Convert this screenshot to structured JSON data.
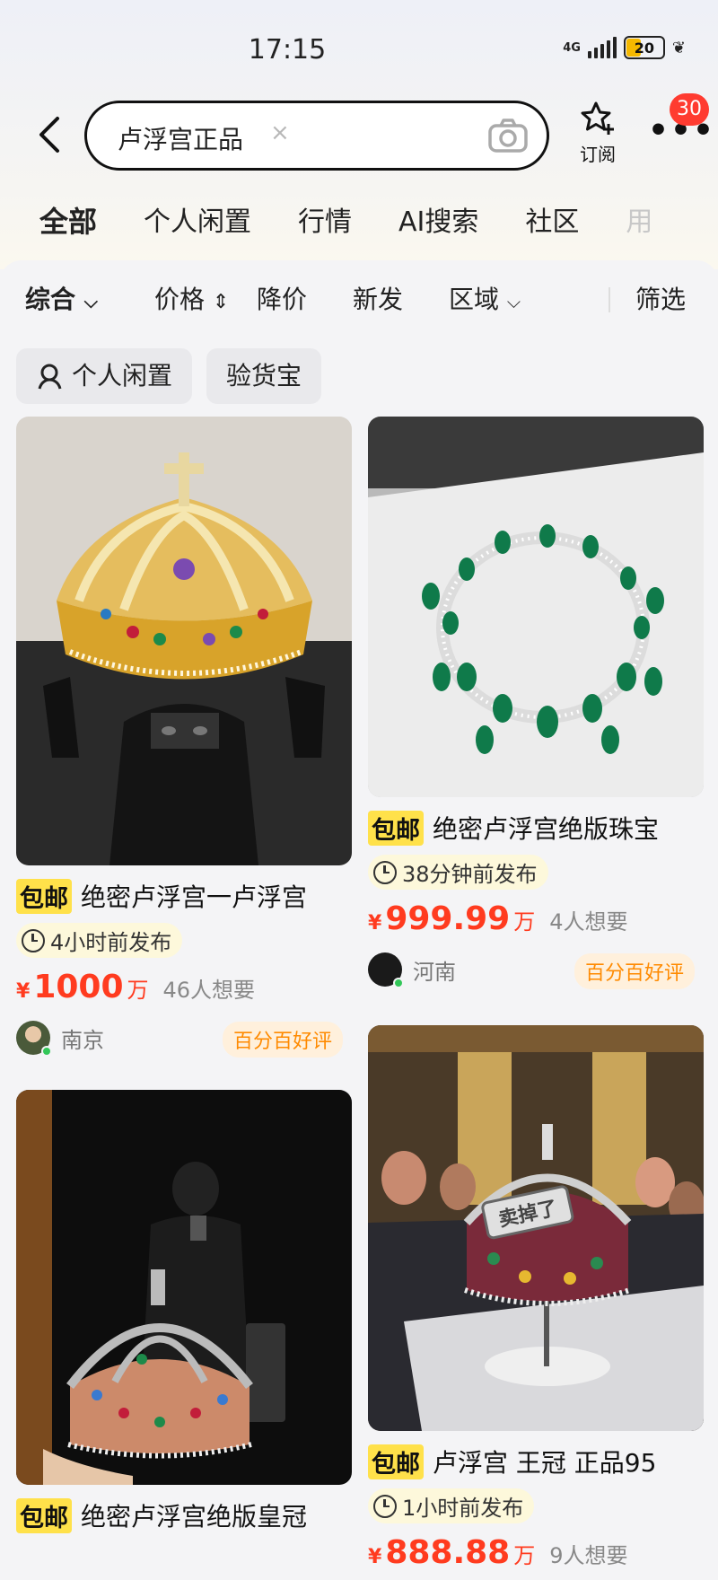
{
  "status_bar": {
    "time": "17:15",
    "network": "4G",
    "battery": "20"
  },
  "search": {
    "query": "卢浮宫正品",
    "clear_icon": "×"
  },
  "header": {
    "subscribe_label": "订阅",
    "message_badge": "30"
  },
  "tabs": [
    {
      "label": "全部",
      "active": true
    },
    {
      "label": "个人闲置"
    },
    {
      "label": "行情"
    },
    {
      "label": "AI搜索"
    },
    {
      "label": "社区"
    },
    {
      "label": "用"
    }
  ],
  "filters": [
    {
      "label": "综合",
      "icon": "chevron-down"
    },
    {
      "label": "价格",
      "icon": "sort-updown"
    },
    {
      "label": "降价"
    },
    {
      "label": "新发"
    },
    {
      "label": "区域",
      "icon": "chevron-down"
    },
    {
      "label": "筛选"
    }
  ],
  "chips": [
    {
      "label": "个人闲置",
      "icon": "person-icon"
    },
    {
      "label": "验货宝"
    }
  ],
  "listings": [
    {
      "image": "crown-held-by-masked-person",
      "tag": "包邮",
      "title": "绝密卢浮宫一卢浮宫",
      "posted": "4小时前发布",
      "currency": "¥",
      "price": "1000",
      "unit": "万",
      "wants": "46人想要",
      "city": "南京",
      "rating": "百分百好评"
    },
    {
      "image": "emerald-diamond-necklace",
      "tag": "包邮",
      "title": "绝密卢浮宫绝版珠宝",
      "posted": "38分钟前发布",
      "currency": "¥",
      "price": "999.99",
      "unit": "万",
      "wants": "4人想要",
      "city": "河南",
      "rating": "百分百好评"
    },
    {
      "image": "crown-selfie-mirror",
      "tag": "包邮",
      "title": "绝密卢浮宫绝版皇冠"
    },
    {
      "image": "crown-museum-display",
      "overlay": "卖掉了",
      "tag": "包邮",
      "title": "卢浮宫 王冠 正品95",
      "posted": "1小时前发布",
      "currency": "¥",
      "price": "888.88",
      "unit": "万",
      "wants": "9人想要"
    }
  ],
  "colors": {
    "accent_yellow": "#ffe14a",
    "price_red": "#ff3b1f",
    "rating_orange": "#ff8a00",
    "badge_red": "#ff3b30"
  }
}
